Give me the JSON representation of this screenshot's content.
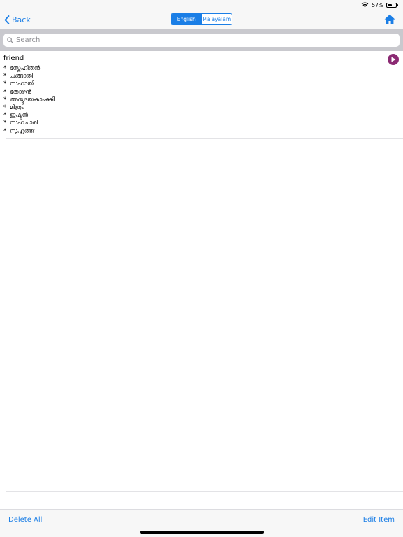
{
  "status_bar": {
    "battery_text": "57%",
    "battery_level": 0.57,
    "icons": [
      "wifi-icon",
      "battery-icon"
    ]
  },
  "nav": {
    "back_label": "Back",
    "segments": [
      {
        "label": "English",
        "selected": true
      },
      {
        "label": "Malayalam",
        "selected": false
      }
    ],
    "icons": [
      "chevron-left-icon",
      "home-icon"
    ]
  },
  "search": {
    "placeholder": "Search",
    "value": "",
    "icon": "search-icon"
  },
  "entry": {
    "word": "friend",
    "meanings": [
      "സ്നേഹിതൻ",
      "ചങ്ങാതി",
      "സഹായി",
      "തോഴൻ",
      "അഭ്യുദയകാംക്ഷി",
      "മിത്രം",
      "ഇഷ്ടൻ",
      "സഹചാരി",
      "സുഹൃത്ത്"
    ],
    "bullet": "*",
    "play_icon": "play-icon"
  },
  "empty_rows": 4,
  "toolbar": {
    "delete_all_label": "Delete All",
    "edit_item_label": "Edit Item"
  },
  "colors": {
    "accent": "#1a7ee6",
    "play": "#8b2a73",
    "search_bg": "#c9c9ce",
    "bar_bg": "#f7f7f7"
  }
}
